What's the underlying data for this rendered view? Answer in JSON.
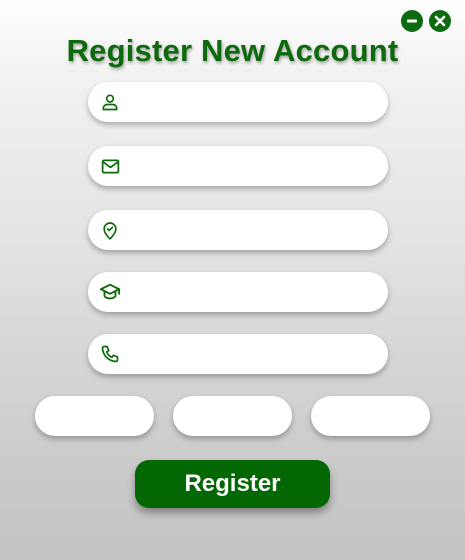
{
  "window": {
    "controls": [
      {
        "name": "minimize",
        "icon": "minus-circle-icon"
      },
      {
        "name": "close",
        "icon": "x-circle-icon"
      }
    ]
  },
  "title": "Register New Account",
  "form": {
    "fields": [
      {
        "id": "name",
        "icon": "user-icon",
        "value": "",
        "placeholder": ""
      },
      {
        "id": "email",
        "icon": "mail-icon",
        "value": "",
        "placeholder": ""
      },
      {
        "id": "location",
        "icon": "map-pin-check-icon",
        "value": "",
        "placeholder": ""
      },
      {
        "id": "education",
        "icon": "graduation-cap-icon",
        "value": "",
        "placeholder": ""
      },
      {
        "id": "phone",
        "icon": "phone-icon",
        "value": "",
        "placeholder": ""
      }
    ],
    "small_fields": [
      {
        "id": "small-1",
        "value": "",
        "placeholder": ""
      },
      {
        "id": "small-2",
        "value": "",
        "placeholder": ""
      },
      {
        "id": "small-3",
        "value": "",
        "placeholder": ""
      }
    ],
    "register_label": "Register"
  },
  "colors": {
    "accent": "#0c6a0c",
    "button": "#036803",
    "field_bg": "#ffffff"
  }
}
